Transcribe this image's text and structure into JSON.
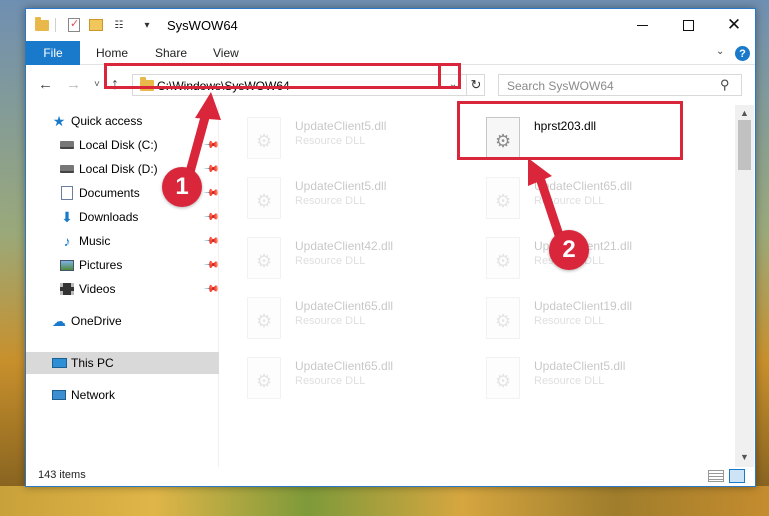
{
  "window": {
    "title": "SysWOW64",
    "controls": {
      "minimize": "—",
      "close": "✕"
    }
  },
  "quick_access": {
    "customize": "▾"
  },
  "ribbon": {
    "file_tab": "File",
    "tabs": [
      "Home",
      "Share",
      "View"
    ],
    "chevron": "⌄",
    "help": "?"
  },
  "nav": {
    "back": "←",
    "forward": "→",
    "recent": "˅",
    "up": "↑",
    "address": "C:\\Windows\\SysWOW64",
    "address_dropdown": "⌄",
    "refresh": "↻",
    "search_placeholder": "Search SysWOW64",
    "search_icon": "⚲"
  },
  "sidebar": {
    "items": [
      {
        "label": "Quick access",
        "icon": "star-icon",
        "pinned": false,
        "selected": false
      },
      {
        "label": "Local Disk (C:)",
        "icon": "drive-icon",
        "pinned": true,
        "selected": false
      },
      {
        "label": "Local Disk (D:)",
        "icon": "drive-icon",
        "pinned": true,
        "selected": false
      },
      {
        "label": "Documents",
        "icon": "document-icon",
        "pinned": true,
        "selected": false
      },
      {
        "label": "Downloads",
        "icon": "download-icon",
        "pinned": true,
        "selected": false
      },
      {
        "label": "Music",
        "icon": "music-icon",
        "pinned": true,
        "selected": false
      },
      {
        "label": "Pictures",
        "icon": "pictures-icon",
        "pinned": true,
        "selected": false
      },
      {
        "label": "Videos",
        "icon": "videos-icon",
        "pinned": true,
        "selected": false
      },
      {
        "label": "OneDrive",
        "icon": "cloud-icon",
        "pinned": false,
        "selected": false
      },
      {
        "label": "This PC",
        "icon": "computer-icon",
        "pinned": false,
        "selected": true
      },
      {
        "label": "Network",
        "icon": "network-icon",
        "pinned": false,
        "selected": false
      }
    ],
    "pin_glyph": "📌"
  },
  "files": [
    {
      "name": "UpdateClient5.dll",
      "type": "Resource DLL",
      "faded": true
    },
    {
      "name": "hprst203.dll",
      "type": "",
      "faded": false
    },
    {
      "name": "UpdateClient5.dll",
      "type": "Resource DLL",
      "faded": true
    },
    {
      "name": "UpdateClient65.dll",
      "type": "Resource DLL",
      "faded": true
    },
    {
      "name": "UpdateClient42.dll",
      "type": "Resource DLL",
      "faded": true
    },
    {
      "name": "UpdateClient21.dll",
      "type": "Resource DLL",
      "faded": true
    },
    {
      "name": "UpdateClient65.dll",
      "type": "Resource DLL",
      "faded": true
    },
    {
      "name": "UpdateClient19.dll",
      "type": "Resource DLL",
      "faded": true
    },
    {
      "name": "UpdateClient65.dll",
      "type": "Resource DLL",
      "faded": true
    },
    {
      "name": "UpdateClient5.dll",
      "type": "Resource DLL",
      "faded": true
    }
  ],
  "scrollbar": {
    "up": "▲",
    "down": "▼"
  },
  "status": {
    "item_count": "143 items"
  },
  "annotations": {
    "badge1": "1",
    "badge2": "2",
    "color": "#d9263b"
  },
  "colors": {
    "accent": "#1979ca",
    "highlight": "#d9263b",
    "selected": "#d9d9d9"
  }
}
